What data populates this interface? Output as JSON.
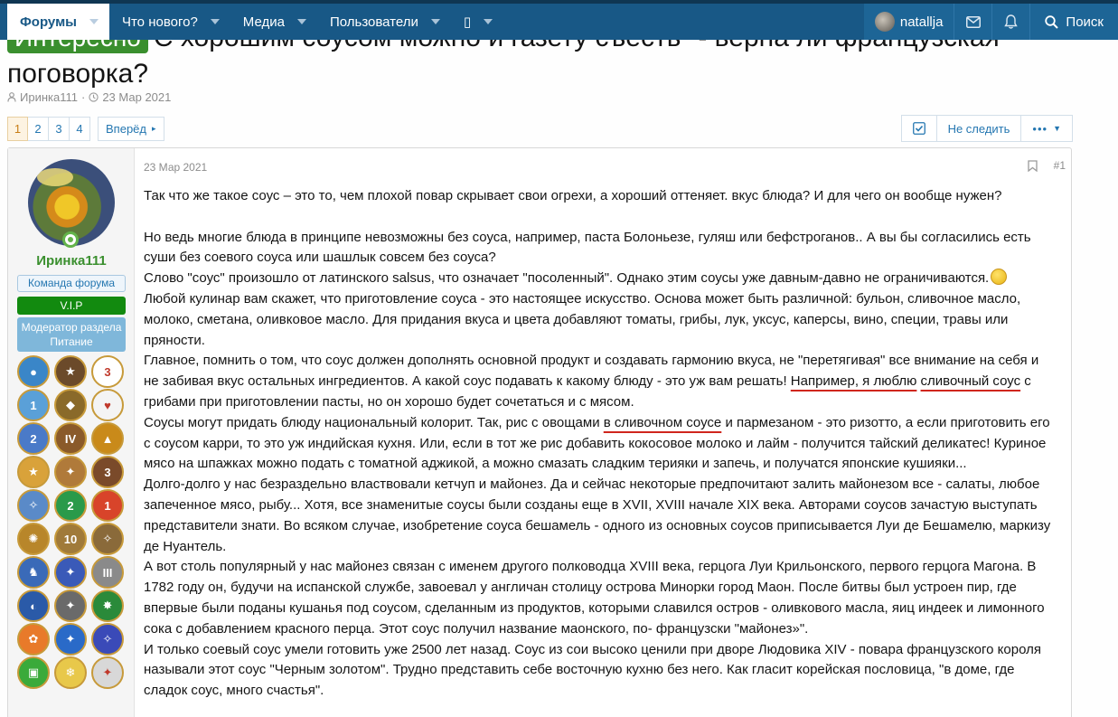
{
  "nav": {
    "items": [
      {
        "label": "Форумы",
        "active": true
      },
      {
        "label": "Что нового?",
        "active": false
      },
      {
        "label": "Медиа",
        "active": false
      },
      {
        "label": "Пользователи",
        "active": false
      },
      {
        "label": "▯",
        "active": false
      }
    ],
    "username": "natallja",
    "search_label": "Поиск"
  },
  "thread": {
    "prefix": "Интересно",
    "title": "С хорошим соусом можно и газету съесть\" - верна ли французская поговорка?",
    "author": "Иринка111",
    "date": "23 Мар 2021"
  },
  "pagination": {
    "pages": [
      "1",
      "2",
      "3",
      "4"
    ],
    "current": "1",
    "next_label": "Вперёд"
  },
  "thread_actions": {
    "unwatch_label": "Не следить",
    "more_label": "•••"
  },
  "post": {
    "username": "Иринка111",
    "user_title": "Команда форума",
    "banner_vip": "V.I.P",
    "banner_mod": "Модератор раздела Питание",
    "date": "23 Мар 2021",
    "number": "#1",
    "awards": [
      {
        "color": "#3a86c8",
        "glyph": "●"
      },
      {
        "color": "#6b4a2a",
        "glyph": "★"
      },
      {
        "color": "#fff",
        "glyph": "3"
      },
      {
        "color": "#5aa0d8",
        "glyph": "1"
      },
      {
        "color": "#8a6a2a",
        "glyph": "◆"
      },
      {
        "color": "#f4f4f4",
        "glyph": "♥"
      },
      {
        "color": "#4a7ac8",
        "glyph": "2"
      },
      {
        "color": "#8a5a2a",
        "glyph": "IV"
      },
      {
        "color": "#c98a1a",
        "glyph": "▲"
      },
      {
        "color": "#d9a23a",
        "glyph": "★"
      },
      {
        "color": "#b07a3a",
        "glyph": "✦"
      },
      {
        "color": "#7a4a2a",
        "glyph": "3"
      },
      {
        "color": "#5a8ac8",
        "glyph": "✧"
      },
      {
        "color": "#2a9a4a",
        "glyph": "2"
      },
      {
        "color": "#d8442a",
        "glyph": "1"
      },
      {
        "color": "#b8862a",
        "glyph": "✺"
      },
      {
        "color": "#a07a3a",
        "glyph": "10"
      },
      {
        "color": "#8a6a3a",
        "glyph": "✧"
      },
      {
        "color": "#3a6ab8",
        "glyph": "♞"
      },
      {
        "color": "#3a5ab8",
        "glyph": "✦"
      },
      {
        "color": "#8a8a8a",
        "glyph": "III"
      },
      {
        "color": "#2a5aa8",
        "glyph": "◐"
      },
      {
        "color": "#6a6a6a",
        "glyph": "✦"
      },
      {
        "color": "#2a8a3a",
        "glyph": "✸"
      },
      {
        "color": "#e87a2a",
        "glyph": "✿"
      },
      {
        "color": "#2a6ac8",
        "glyph": "✦"
      },
      {
        "color": "#3a4ab8",
        "glyph": "✧"
      },
      {
        "color": "#3aaa3a",
        "glyph": "▣"
      },
      {
        "color": "#e8c84a",
        "glyph": "❄"
      },
      {
        "color": "#d8d8d8",
        "glyph": "✦"
      }
    ],
    "paragraphs": [
      "Так что же такое соус – это то, чем плохой повар скрывает свои огрехи, а хороший оттеняет. вкус блюда? И для чего он вообще нужен?",
      " ",
      "Но ведь многие блюда в принципе невозможны без соуса, например, паста Болоньезе, гуляш или бефстроганов.. А вы бы согласились есть суши без соевого соуса или шашлык совсем без соуса?",
      "Слово \"соус\" произошло от латинского salsus, что означает \"посоленный\". Однако этим соусы уже давным-давно не ограничиваются.",
      "Любой кулинар вам скажет, что приготовление соуса - это настоящее искусство. Основа может быть различной: бульон, сливочное масло, молоко, сметана, оливковое масло. Для придания вкуса и цвета добавляют томаты, грибы, лук, уксус, каперсы, вино, специи, травы или пряности."
    ],
    "p6_a": "Главное, помнить о том, что соус должен дополнять основной продукт и создавать гармонию вкуса, не \"перетягивая\" все внимание на себя и не забивая вкус остальных ингредиентов. А какой соус подавать к какому блюду - это уж вам решать! ",
    "p6_ul1": "Например, я люблю",
    "p6_gap": " ",
    "p6_ul2": "сливочный соус",
    "p6_b": " с грибами при приготовлении пасты, но он хорошо будет сочетаться и с мясом.",
    "p7_a": "Соусы могут придать блюду национальный колорит. Так, рис с овощами ",
    "p7_ul": "в сливочном соусе",
    "p7_b": " и пармезаном - это ризотто, а если приготовить его с соусом карри, то это уж индийская кухня. Или, если в тот же рис добавить кокосовое молоко и лайм - получится тайский деликатес! Куриное мясо на шпажках можно подать с томатной аджикой, а можно смазать сладким терияки и запечь, и получатся японские кушияки...",
    "paragraphs_tail": [
      "Долго-долго у нас безраздельно властвовали кетчуп и майонез. Да и сейчас некоторые предпочитают залить майонезом все - салаты, любое запеченное мясо, рыбу... Хотя, все знаменитые соусы были созданы еще в XVII, XVIII начале XIX века. Авторами соусов зачастую выступать представители знати. Во всяком случае, изобретение соуса бешамель - одного из основных соусов приписывается Луи де Бешамелю, маркизу де Нуантель.",
      "А вот столь популярный у нас майонез связан с именем другого полководца XVIII века, герцога Луи Крильонского, первого герцога Магона. В 1782 году он, будучи на испанской службе, завоевал у англичан столицу острова Минорки город Маон. После битвы был устроен пир, где впервые были поданы кушанья под соусом, сделанным из продуктов, которыми славился остров - оливкового масла, яиц индеек и лимонного сока с добавлением красного перца. Этот соус получил название маонского, по- французски \"майонез»\".",
      "И только соевый соус умели готовить уже 2500 лет назад. Соус из сои высоко ценили при дворе Людовика XIV - повара французского короля называли этот соус \"Черным золотом\". Трудно представить себе восточную кухню без него. Как гласит корейская пословица, \"в доме, где сладок соус, много счастья\"."
    ]
  }
}
